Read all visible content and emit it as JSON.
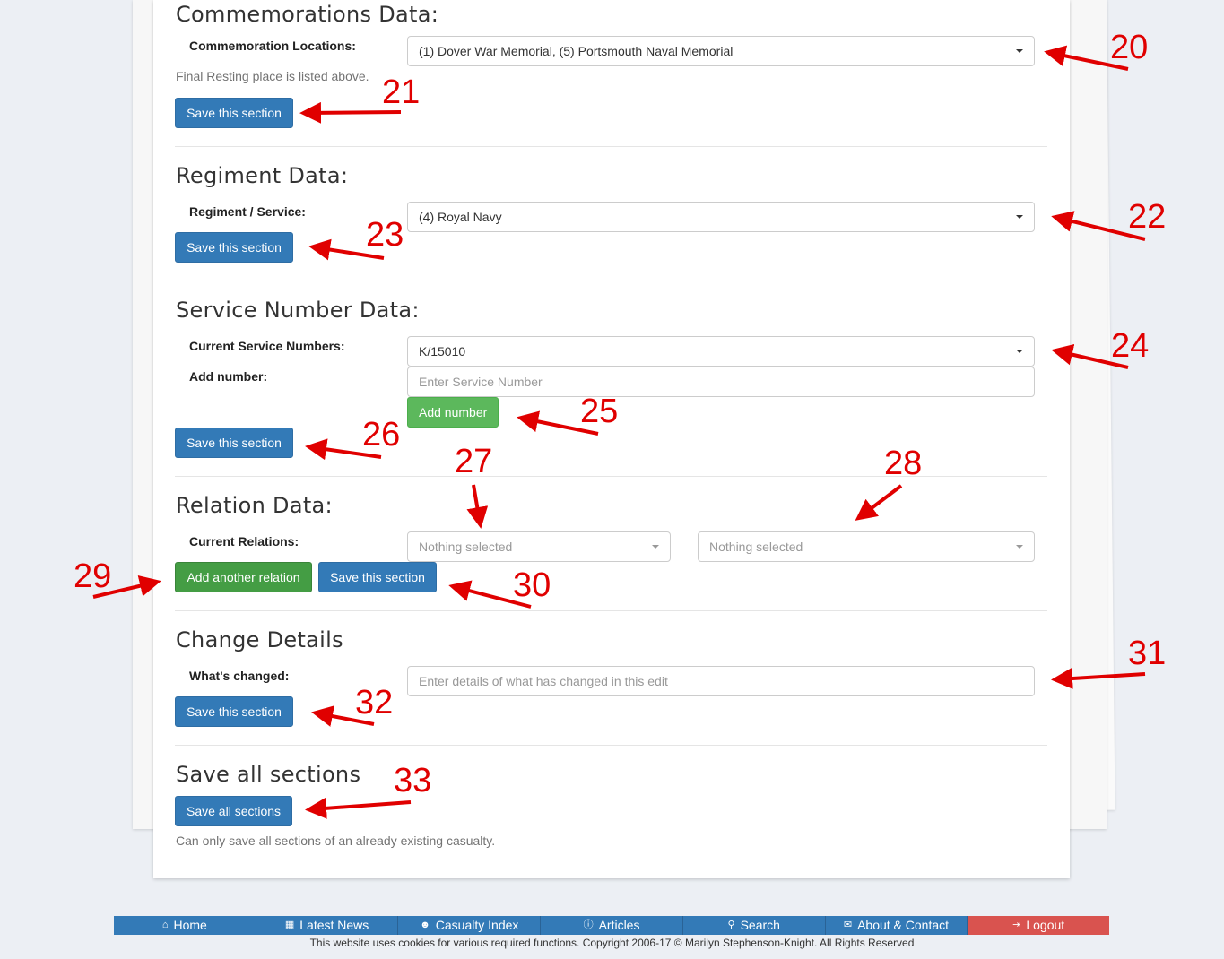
{
  "commemorations": {
    "heading": "Commemorations Data:",
    "locations_label": "Commemoration Locations:",
    "locations_value": "(1) Dover War Memorial, (5) Portsmouth Naval Memorial",
    "help": "Final Resting place is listed above.",
    "save_label": "Save this section"
  },
  "regiment": {
    "heading": "Regiment Data:",
    "label": "Regiment / Service:",
    "value": "(4) Royal Navy",
    "save_label": "Save this section"
  },
  "service_number": {
    "heading": "Service Number Data:",
    "current_label": "Current Service Numbers:",
    "current_value": "K/15010",
    "add_label": "Add number:",
    "add_placeholder": "Enter Service Number",
    "add_button": "Add number",
    "save_label": "Save this section"
  },
  "relation": {
    "heading": "Relation Data:",
    "label": "Current Relations:",
    "select1": "Nothing selected",
    "select2": "Nothing selected",
    "add_button": "Add another relation",
    "save_label": "Save this section"
  },
  "change": {
    "heading": "Change Details",
    "label": "What's changed:",
    "placeholder": "Enter details of what has changed in this edit",
    "save_label": "Save this section"
  },
  "save_all": {
    "heading": "Save all sections",
    "button": "Save all sections",
    "help": "Can only save all sections of an already existing casualty."
  },
  "annotations": [
    "20",
    "21",
    "22",
    "23",
    "24",
    "25",
    "26",
    "27",
    "28",
    "29",
    "30",
    "31",
    "32",
    "33"
  ],
  "annotation_color": "#e00000",
  "footer": {
    "nav": [
      {
        "icon": "home-icon",
        "glyph": "⌂",
        "label": "Home"
      },
      {
        "icon": "calendar-icon",
        "glyph": "▦",
        "label": "Latest News"
      },
      {
        "icon": "users-icon",
        "glyph": "☻",
        "label": "Casualty Index"
      },
      {
        "icon": "info-icon",
        "glyph": "ⓘ",
        "label": "Articles"
      },
      {
        "icon": "search-icon",
        "glyph": "⚲",
        "label": "Search"
      },
      {
        "icon": "envelope-icon",
        "glyph": "✉",
        "label": "About & Contact"
      },
      {
        "icon": "logout-icon",
        "glyph": "⇥",
        "label": "Logout"
      }
    ],
    "copyright": "This website uses cookies for various required functions. Copyright 2006-17 © Marilyn Stephenson-Knight. All Rights Reserved"
  },
  "colors": {
    "primary": "#337ab7",
    "success": "#5cb85c",
    "danger": "#d9534f",
    "background": "#eceff4"
  }
}
